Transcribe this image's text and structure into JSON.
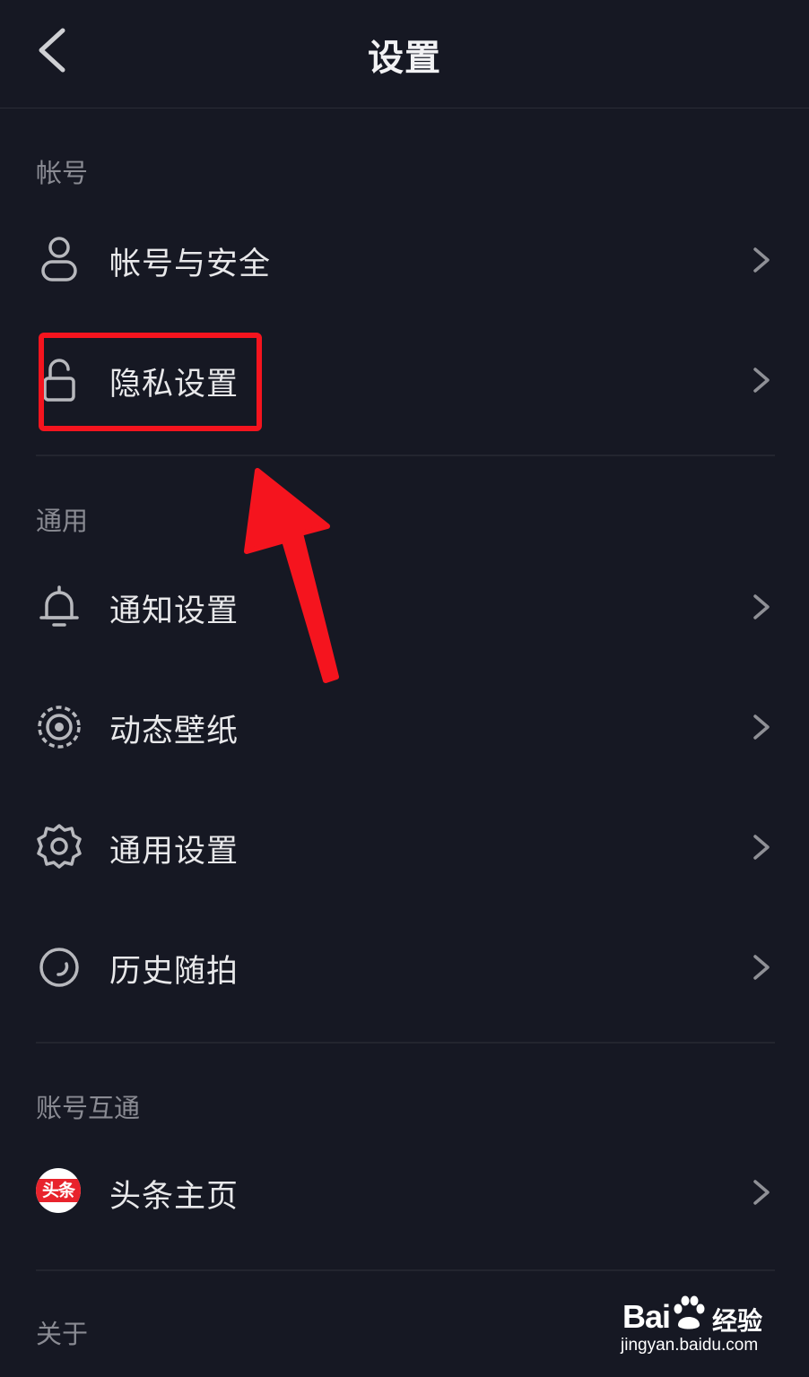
{
  "header": {
    "title": "设置"
  },
  "sections": {
    "account": {
      "header": "帐号",
      "items": [
        {
          "label": "帐号与安全",
          "icon": "user-icon"
        },
        {
          "label": "隐私设置",
          "icon": "lock-icon"
        }
      ]
    },
    "general": {
      "header": "通用",
      "items": [
        {
          "label": "通知设置",
          "icon": "bell-icon"
        },
        {
          "label": "动态壁纸",
          "icon": "live-wallpaper-icon"
        },
        {
          "label": "通用设置",
          "icon": "gear-icon"
        },
        {
          "label": "历史随拍",
          "icon": "history-icon"
        }
      ]
    },
    "linked": {
      "header": "账号互通",
      "items": [
        {
          "label": "头条主页",
          "icon": "toutiao-logo",
          "logo_text": "头条"
        }
      ]
    },
    "about": {
      "header": "关于"
    }
  },
  "annotation": {
    "highlight_color": "#f5141e"
  },
  "watermark": {
    "brand": "Bai",
    "cn": "经验",
    "url": "jingyan.baidu.com"
  },
  "colors": {
    "background": "#161823",
    "text": "#e8e8ea",
    "muted": "#8a8b93",
    "accent": "#e8232c"
  }
}
